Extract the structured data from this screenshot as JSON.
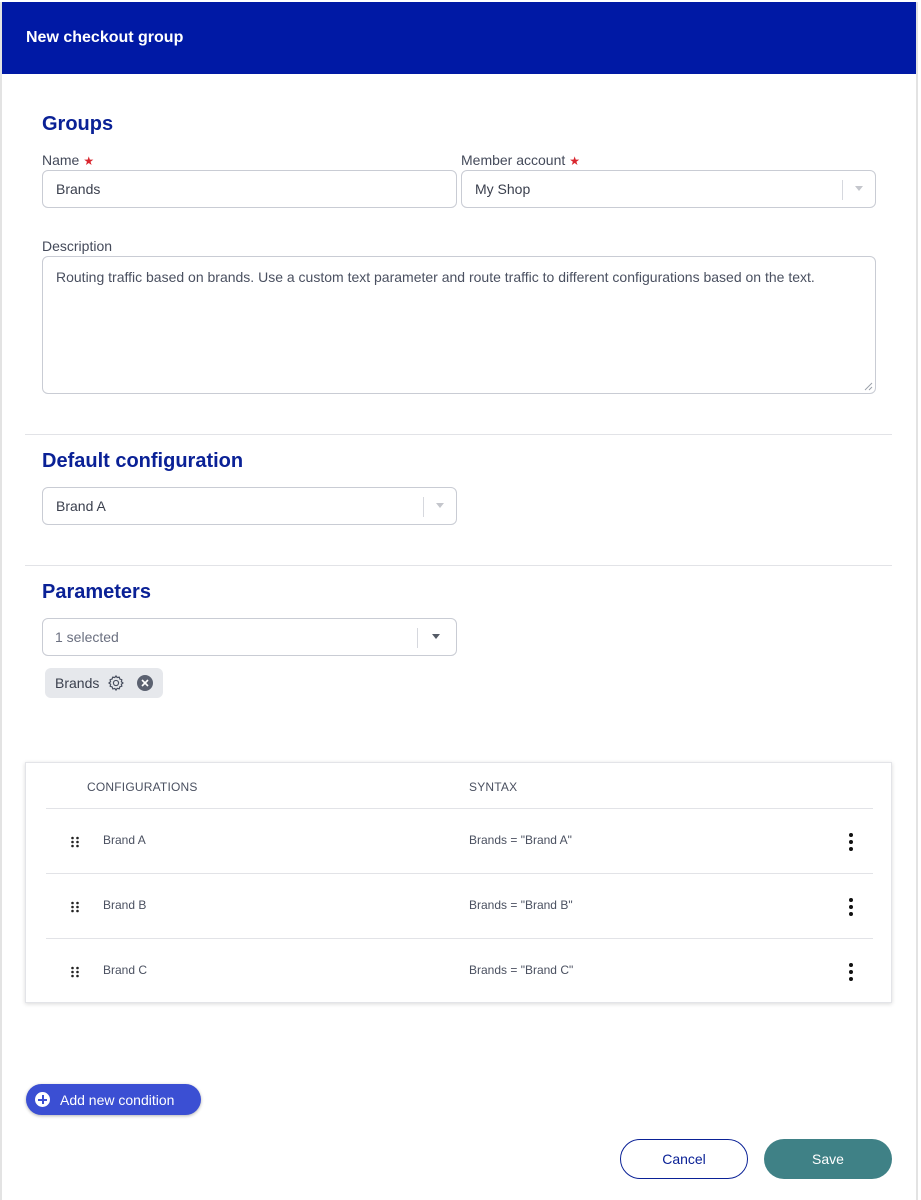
{
  "header": {
    "title": "New checkout group"
  },
  "groups": {
    "title": "Groups",
    "name_label": "Name",
    "name_value": "Brands",
    "member_label": "Member account",
    "member_value": "My Shop",
    "required_mark": "★",
    "description_label": "Description",
    "description_value": "Routing traffic based on brands. Use a custom text parameter and route traffic to different configurations based on the text."
  },
  "default_config": {
    "title": "Default configuration",
    "value": "Brand A"
  },
  "parameters": {
    "title": "Parameters",
    "select_value": "1 selected",
    "chip_label": "Brands"
  },
  "table": {
    "columns": [
      "CONFIGURATIONS",
      "SYNTAX"
    ],
    "rows": [
      {
        "config": "Brand A",
        "syntax": "Brands = \"Brand A\""
      },
      {
        "config": "Brand B",
        "syntax": "Brands = \"Brand B\""
      },
      {
        "config": "Brand C",
        "syntax": "Brands = \"Brand C\""
      }
    ]
  },
  "actions": {
    "add_condition": "Add new condition",
    "cancel": "Cancel",
    "save": "Save"
  },
  "colors": {
    "header_bg": "#0019a5",
    "section_title": "#0a2196",
    "add_button": "#3b4fd3",
    "save_button": "#3f8186",
    "required": "#d9262e"
  }
}
